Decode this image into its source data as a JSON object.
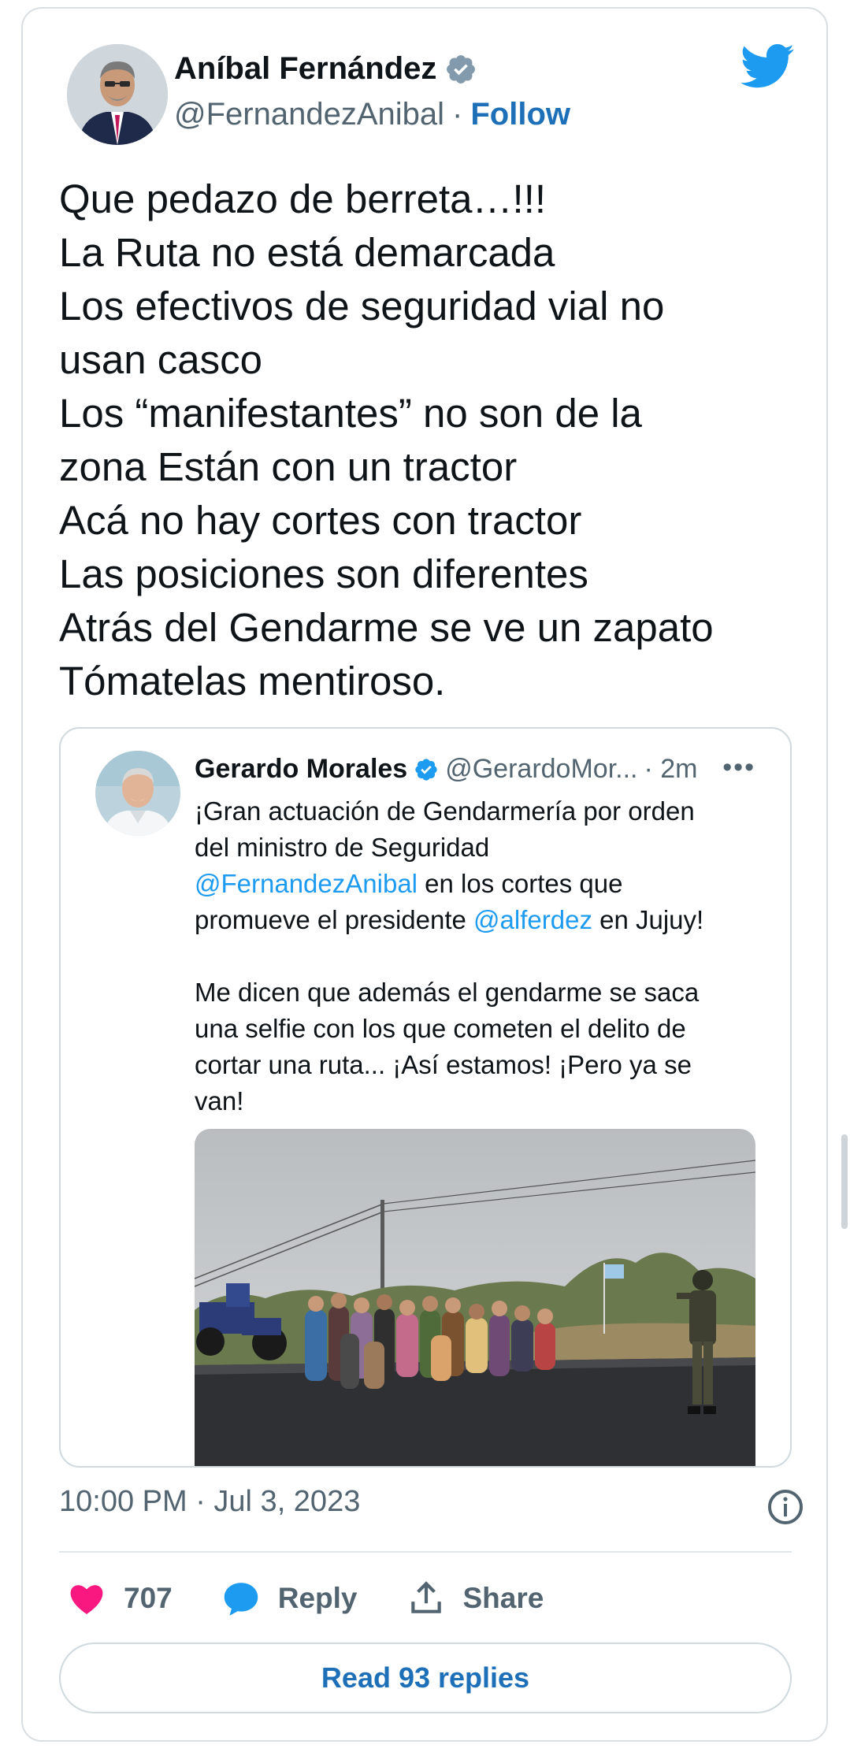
{
  "author": {
    "name": "Aníbal Fernández",
    "handle": "@FernandezAnibal",
    "separator": "·",
    "follow_label": "Follow"
  },
  "tweet_lines": [
    "Que pedazo de berreta…!!!",
    "La Ruta no está demarcada",
    "Los efectivos de seguridad vial no",
    "usan casco",
    "Los “manifestantes” no son de la",
    "zona Están con un tractor",
    "Acá no hay cortes con tractor",
    "Las posiciones son diferentes",
    "Atrás del Gendarme se ve un zapato",
    "Tómatelas mentiroso."
  ],
  "quote": {
    "name": "Gerardo Morales",
    "handle": "@GerardoMor...",
    "time": "· 2m",
    "more": "•••",
    "line1": "¡Gran actuación de Gendarmería por orden",
    "line2": "del ministro de Seguridad",
    "line3_mention": "@FernandezAnibal",
    "line3_rest": " en los cortes que",
    "line4_pre": "promueve el presidente ",
    "line4_mention": "@alferdez",
    "line4_post": " en Jujuy!",
    "line5": "Me dicen que además el gendarme se saca",
    "line6": "una selfie con los que cometen el delito de",
    "line7": "cortar una ruta... ¡Así estamos! ¡Pero ya se",
    "line8": "van!"
  },
  "timestamp": "10:00 PM · Jul 3, 2023",
  "actions": {
    "likes": "707",
    "reply_label": "Reply",
    "share_label": "Share"
  },
  "read_replies_label": "Read 93 replies",
  "colors": {
    "accent_link": "#1d9bf0",
    "follow_blue": "#1d6fb8",
    "heart": "#f91880",
    "verified_gray": "#829aab"
  },
  "icons": [
    "verified-icon",
    "twitter-bird-icon",
    "more-icon",
    "info-icon",
    "heart-icon",
    "reply-bubble-icon",
    "share-icon"
  ]
}
